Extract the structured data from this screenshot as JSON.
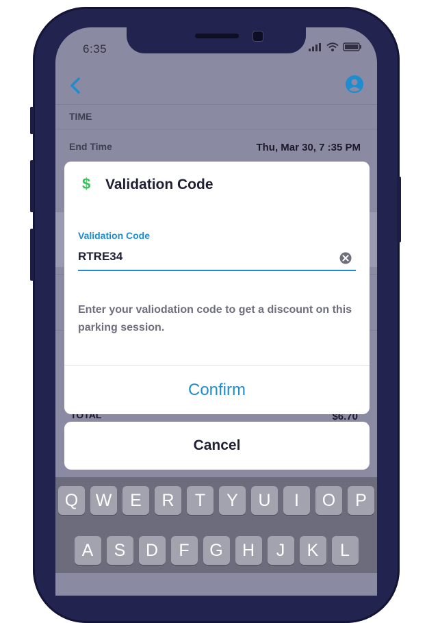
{
  "status_bar": {
    "time": "6:35"
  },
  "nav": {
    "back_icon": "chevron-left-icon",
    "account_icon": "account-circle-icon"
  },
  "details": {
    "section_label": "TIME",
    "end_time_label": "End Time",
    "end_time_value": "Thu, Mar 30, 7 :35 PM",
    "total_label": "TOTAL",
    "total_value": "$6.70"
  },
  "dialog": {
    "icon_glyph": "$",
    "title": "Validation Code",
    "field_label": "Validation Code",
    "field_value": "RTRE34",
    "help_text": "Enter your valiodation code to get a discount on this parking session.",
    "confirm_label": "Confirm"
  },
  "sheet": {
    "cancel_label": "Cancel"
  },
  "keyboard": {
    "row1": [
      "Q",
      "W",
      "E",
      "R",
      "T",
      "Y",
      "U",
      "I",
      "O",
      "P"
    ],
    "row2": [
      "A",
      "S",
      "D",
      "F",
      "G",
      "H",
      "J",
      "K",
      "L"
    ]
  },
  "colors": {
    "accent": "#1e8ccf",
    "success": "#35c45a",
    "phone_frame": "#23234f",
    "overlay": "#8a8aa3"
  }
}
